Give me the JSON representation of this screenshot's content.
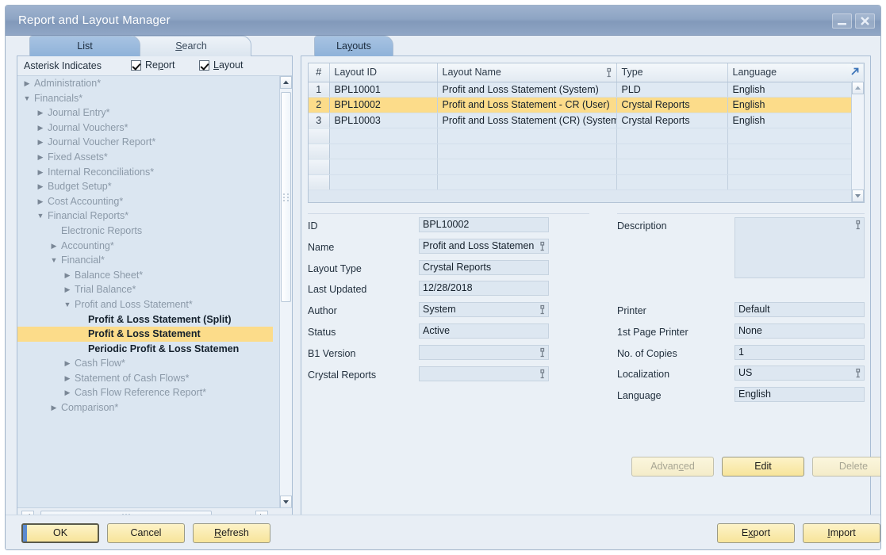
{
  "window": {
    "title": "Report and Layout Manager",
    "minimize_icon": "minimize-icon",
    "close_icon": "close-icon"
  },
  "left_panel": {
    "tabs": [
      {
        "label": "List",
        "active": true
      },
      {
        "label": "Search",
        "active": false,
        "accel": "S"
      }
    ],
    "asterisk_label": "Asterisk Indicates",
    "checkboxes": [
      {
        "label": "Report",
        "checked": true,
        "accel": "p"
      },
      {
        "label": "Layout",
        "checked": true,
        "accel": "L"
      }
    ],
    "tree": [
      {
        "label": "Administration*",
        "depth": 0,
        "state": "collapsed",
        "style": "dim"
      },
      {
        "label": "Financials*",
        "depth": 0,
        "state": "expanded",
        "style": "dim"
      },
      {
        "label": "Journal Entry*",
        "depth": 1,
        "state": "collapsed",
        "style": "dim"
      },
      {
        "label": "Journal Vouchers*",
        "depth": 1,
        "state": "collapsed",
        "style": "dim"
      },
      {
        "label": "Journal Voucher Report*",
        "depth": 1,
        "state": "collapsed",
        "style": "dim"
      },
      {
        "label": "Fixed Assets*",
        "depth": 1,
        "state": "collapsed",
        "style": "dim"
      },
      {
        "label": "Internal Reconciliations*",
        "depth": 1,
        "state": "collapsed",
        "style": "dim"
      },
      {
        "label": "Budget Setup*",
        "depth": 1,
        "state": "collapsed",
        "style": "dim"
      },
      {
        "label": "Cost Accounting*",
        "depth": 1,
        "state": "collapsed",
        "style": "dim"
      },
      {
        "label": "Financial Reports*",
        "depth": 1,
        "state": "expanded",
        "style": "dim"
      },
      {
        "label": "Electronic Reports",
        "depth": 2,
        "state": "none",
        "style": "dim"
      },
      {
        "label": "Accounting*",
        "depth": 2,
        "state": "collapsed",
        "style": "dim"
      },
      {
        "label": "Financial*",
        "depth": 2,
        "state": "expanded",
        "style": "dim"
      },
      {
        "label": "Balance Sheet*",
        "depth": 3,
        "state": "collapsed",
        "style": "dim"
      },
      {
        "label": "Trial Balance*",
        "depth": 3,
        "state": "collapsed",
        "style": "dim"
      },
      {
        "label": "Profit and Loss Statement*",
        "depth": 3,
        "state": "expanded",
        "style": "dim"
      },
      {
        "label": "Profit & Loss Statement (Split)",
        "depth": 4,
        "state": "none",
        "style": "leaf"
      },
      {
        "label": "Profit & Loss Statement",
        "depth": 4,
        "state": "none",
        "style": "leaf",
        "selected": true
      },
      {
        "label": "Periodic Profit & Loss Statemen",
        "depth": 4,
        "state": "none",
        "style": "leaf"
      },
      {
        "label": "Cash Flow*",
        "depth": 3,
        "state": "collapsed",
        "style": "dim"
      },
      {
        "label": "Statement of Cash Flows*",
        "depth": 3,
        "state": "collapsed",
        "style": "dim"
      },
      {
        "label": "Cash Flow Reference Report*",
        "depth": 3,
        "state": "collapsed",
        "style": "dim"
      },
      {
        "label": "Comparison*",
        "depth": 2,
        "state": "collapsed",
        "style": "dim"
      }
    ]
  },
  "right_panel": {
    "tab": {
      "label": "Layouts",
      "accel": "y",
      "active": true
    },
    "grid": {
      "columns": [
        "#",
        "Layout ID",
        "Layout Name",
        "Type",
        "Language"
      ],
      "layout_name_has_link_icon": true,
      "rows": [
        {
          "num": "1",
          "layout_id": "BPL10001",
          "layout_name": "Profit and Loss Statement (System)",
          "type": "PLD",
          "language": "English",
          "selected": false
        },
        {
          "num": "2",
          "layout_id": "BPL10002",
          "layout_name": "Profit and Loss Statement - CR (User)",
          "type": "Crystal Reports",
          "language": "English",
          "selected": true
        },
        {
          "num": "3",
          "layout_id": "BPL10003",
          "layout_name": "Profit and Loss Statement (CR) (System)",
          "type": "Crystal Reports",
          "language": "English",
          "selected": false
        }
      ],
      "empty_rows": 4,
      "expand_icon": "expand-arrow-icon"
    },
    "form_left": [
      {
        "label": "ID",
        "value": "BPL10002",
        "link": false
      },
      {
        "label": "Name",
        "value": "Profit and Loss Statemen",
        "link": true
      },
      {
        "label": "Layout Type",
        "value": "Crystal Reports",
        "link": false
      },
      {
        "label": "Last Updated",
        "value": "12/28/2018",
        "link": false
      },
      {
        "label": "Author",
        "value": "System",
        "link": true
      },
      {
        "label": "Status",
        "value": "Active",
        "link": false
      },
      {
        "label": "B1 Version",
        "value": "",
        "link": true
      },
      {
        "label": "Crystal Reports",
        "value": "",
        "link": true
      }
    ],
    "form_right": {
      "description_label": "Description",
      "description_value": "",
      "description_link": true,
      "fields": [
        {
          "label": "Printer",
          "value": "Default",
          "link": false
        },
        {
          "label": "1st Page Printer",
          "value": "None",
          "link": false
        },
        {
          "label": "No. of Copies",
          "value": "1",
          "link": false
        },
        {
          "label": "Localization",
          "value": "US",
          "link": true
        },
        {
          "label": "Language",
          "value": "English",
          "link": false
        }
      ]
    },
    "action_buttons": [
      {
        "label": "Advanced",
        "state": "disabled",
        "accel": "c"
      },
      {
        "label": "Edit",
        "state": "enabled"
      },
      {
        "label": "Delete",
        "state": "disabled"
      }
    ]
  },
  "bottom_bar": {
    "left_buttons": [
      {
        "label": "OK",
        "state": "focused"
      },
      {
        "label": "Cancel",
        "state": "enabled"
      },
      {
        "label": "Refresh",
        "state": "enabled",
        "accel": "R"
      }
    ],
    "right_buttons": [
      {
        "label": "Export",
        "state": "enabled",
        "accel": "x"
      },
      {
        "label": "Import",
        "state": "enabled",
        "accel": "I"
      }
    ]
  },
  "colors": {
    "titlebar": "#8ea5c4",
    "selection": "#fcdc8a",
    "panel_bg": "#e8eef5",
    "field_bg": "#dde7f1",
    "button_yellow": "#f7e49a",
    "accent_blue": "#5b8ad0"
  }
}
